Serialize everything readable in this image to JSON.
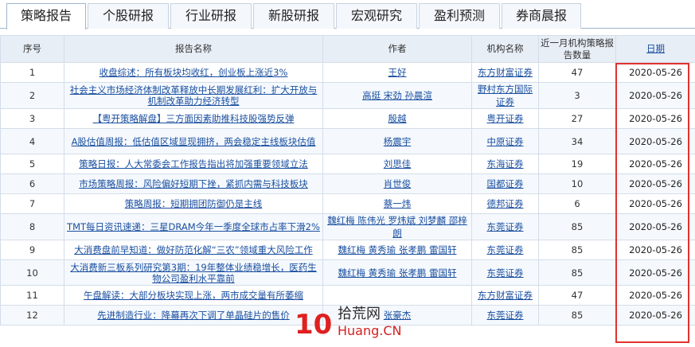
{
  "tabs": [
    {
      "label": "策略报告",
      "active": true
    },
    {
      "label": "个股研报",
      "active": false
    },
    {
      "label": "行业研报",
      "active": false
    },
    {
      "label": "新股研报",
      "active": false
    },
    {
      "label": "宏观研究",
      "active": false
    },
    {
      "label": "盈利预测",
      "active": false
    },
    {
      "label": "券商晨报",
      "active": false
    }
  ],
  "table": {
    "headers": {
      "index": "序号",
      "title": "报告名称",
      "author": "作者",
      "org": "机构名称",
      "count": "近一月机构策略报告数量",
      "date": "日期"
    },
    "rows": [
      {
        "index": "1",
        "title": "收盘综述：所有板块均收红，创业板上涨近3%",
        "author": "王好",
        "org": "东方财富证券",
        "count": "47",
        "date": "2020-05-26"
      },
      {
        "index": "2",
        "title": "社会主义市场经济体制改革释放中长期发展红利：扩大开放与机制改革助力经济转型",
        "author": "高挺 宋劲 孙晨渲",
        "org": "野村东方国际证券",
        "count": "3",
        "date": "2020-05-26"
      },
      {
        "index": "3",
        "title": "【粤开策略解盘】三方面因素助推科技股强势反弹",
        "author": "殷越",
        "org": "粤开证券",
        "count": "27",
        "date": "2020-05-26"
      },
      {
        "index": "4",
        "title": "A股估值周报：低估值区域显现拥挤，两会稳定主线板块估值",
        "author": "杨震宇",
        "org": "中原证券",
        "count": "34",
        "date": "2020-05-26"
      },
      {
        "index": "5",
        "title": "策略日报：人大常委会工作报告指出将加强重要领域立法",
        "author": "刘思佳",
        "org": "东海证券",
        "count": "19",
        "date": "2020-05-26"
      },
      {
        "index": "6",
        "title": "市场策略周报：风险偏好短期下挫，紧抓内需与科技板块",
        "author": "肖世俊",
        "org": "国都证券",
        "count": "10",
        "date": "2020-05-26"
      },
      {
        "index": "7",
        "title": "策略周报：短期拥团防御仍是主线",
        "author": "蔡一炜",
        "org": "德邦证券",
        "count": "6",
        "date": "2020-05-26"
      },
      {
        "index": "8",
        "title": "TMT每日资讯速递：三星DRAM今年一季度全球市占率下滑2%",
        "author": "魏红梅 陈伟光 罗炜斌 刘梦麟 邵梓朗",
        "org": "东莞证券",
        "count": "85",
        "date": "2020-05-26"
      },
      {
        "index": "9",
        "title": "大消费盘前早知道：做好防范化解“三农”领域重大风险工作",
        "author": "魏红梅 黄秀瑜 张孝鹏 雷国轩",
        "org": "东莞证券",
        "count": "85",
        "date": "2020-05-26"
      },
      {
        "index": "10",
        "title": "大消费新三板系列研究第3期：19年整体业绩稳增长，医药生物公司盈利水平靠前",
        "author": "魏红梅 黄秀瑜 张孝鹏 雷国轩",
        "org": "东莞证券",
        "count": "85",
        "date": "2020-05-26"
      },
      {
        "index": "11",
        "title": "午盘解读：大部分板块实现上涨，两市成交量有所萎缩",
        "author": "",
        "org": "东方财富证券",
        "count": "47",
        "date": "2020-05-26"
      },
      {
        "index": "12",
        "title": "先进制造行业：降幕再次下调了单晶硅片的售价",
        "author": "张豪杰",
        "org": "东莞证券",
        "count": "85",
        "date": "2020-05-26"
      }
    ]
  },
  "watermark": {
    "logo": "10",
    "name": "拾荒网",
    "url": "Huang.CN"
  },
  "colors": {
    "link": "#1a4fa0",
    "highlight_border": "#e0332e",
    "header_bg": "#e8eef6"
  }
}
